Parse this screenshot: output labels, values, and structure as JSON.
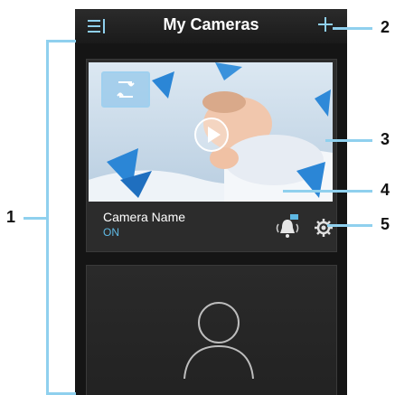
{
  "header": {
    "title": "My Cameras"
  },
  "camera": {
    "name": "Camera Name",
    "status": "ON"
  },
  "callouts": [
    "1",
    "2",
    "3",
    "4",
    "5"
  ],
  "icons": {
    "menu": "menu-icon",
    "add": "plus-icon",
    "switch": "switch-camera-icon",
    "play": "play-icon",
    "alert": "bell-alert-icon",
    "settings": "gear-icon",
    "placeholder": "person-placeholder-icon"
  },
  "colors": {
    "accent": "#8fd0ee",
    "status": "#5fb9e4",
    "background": "#151515"
  }
}
